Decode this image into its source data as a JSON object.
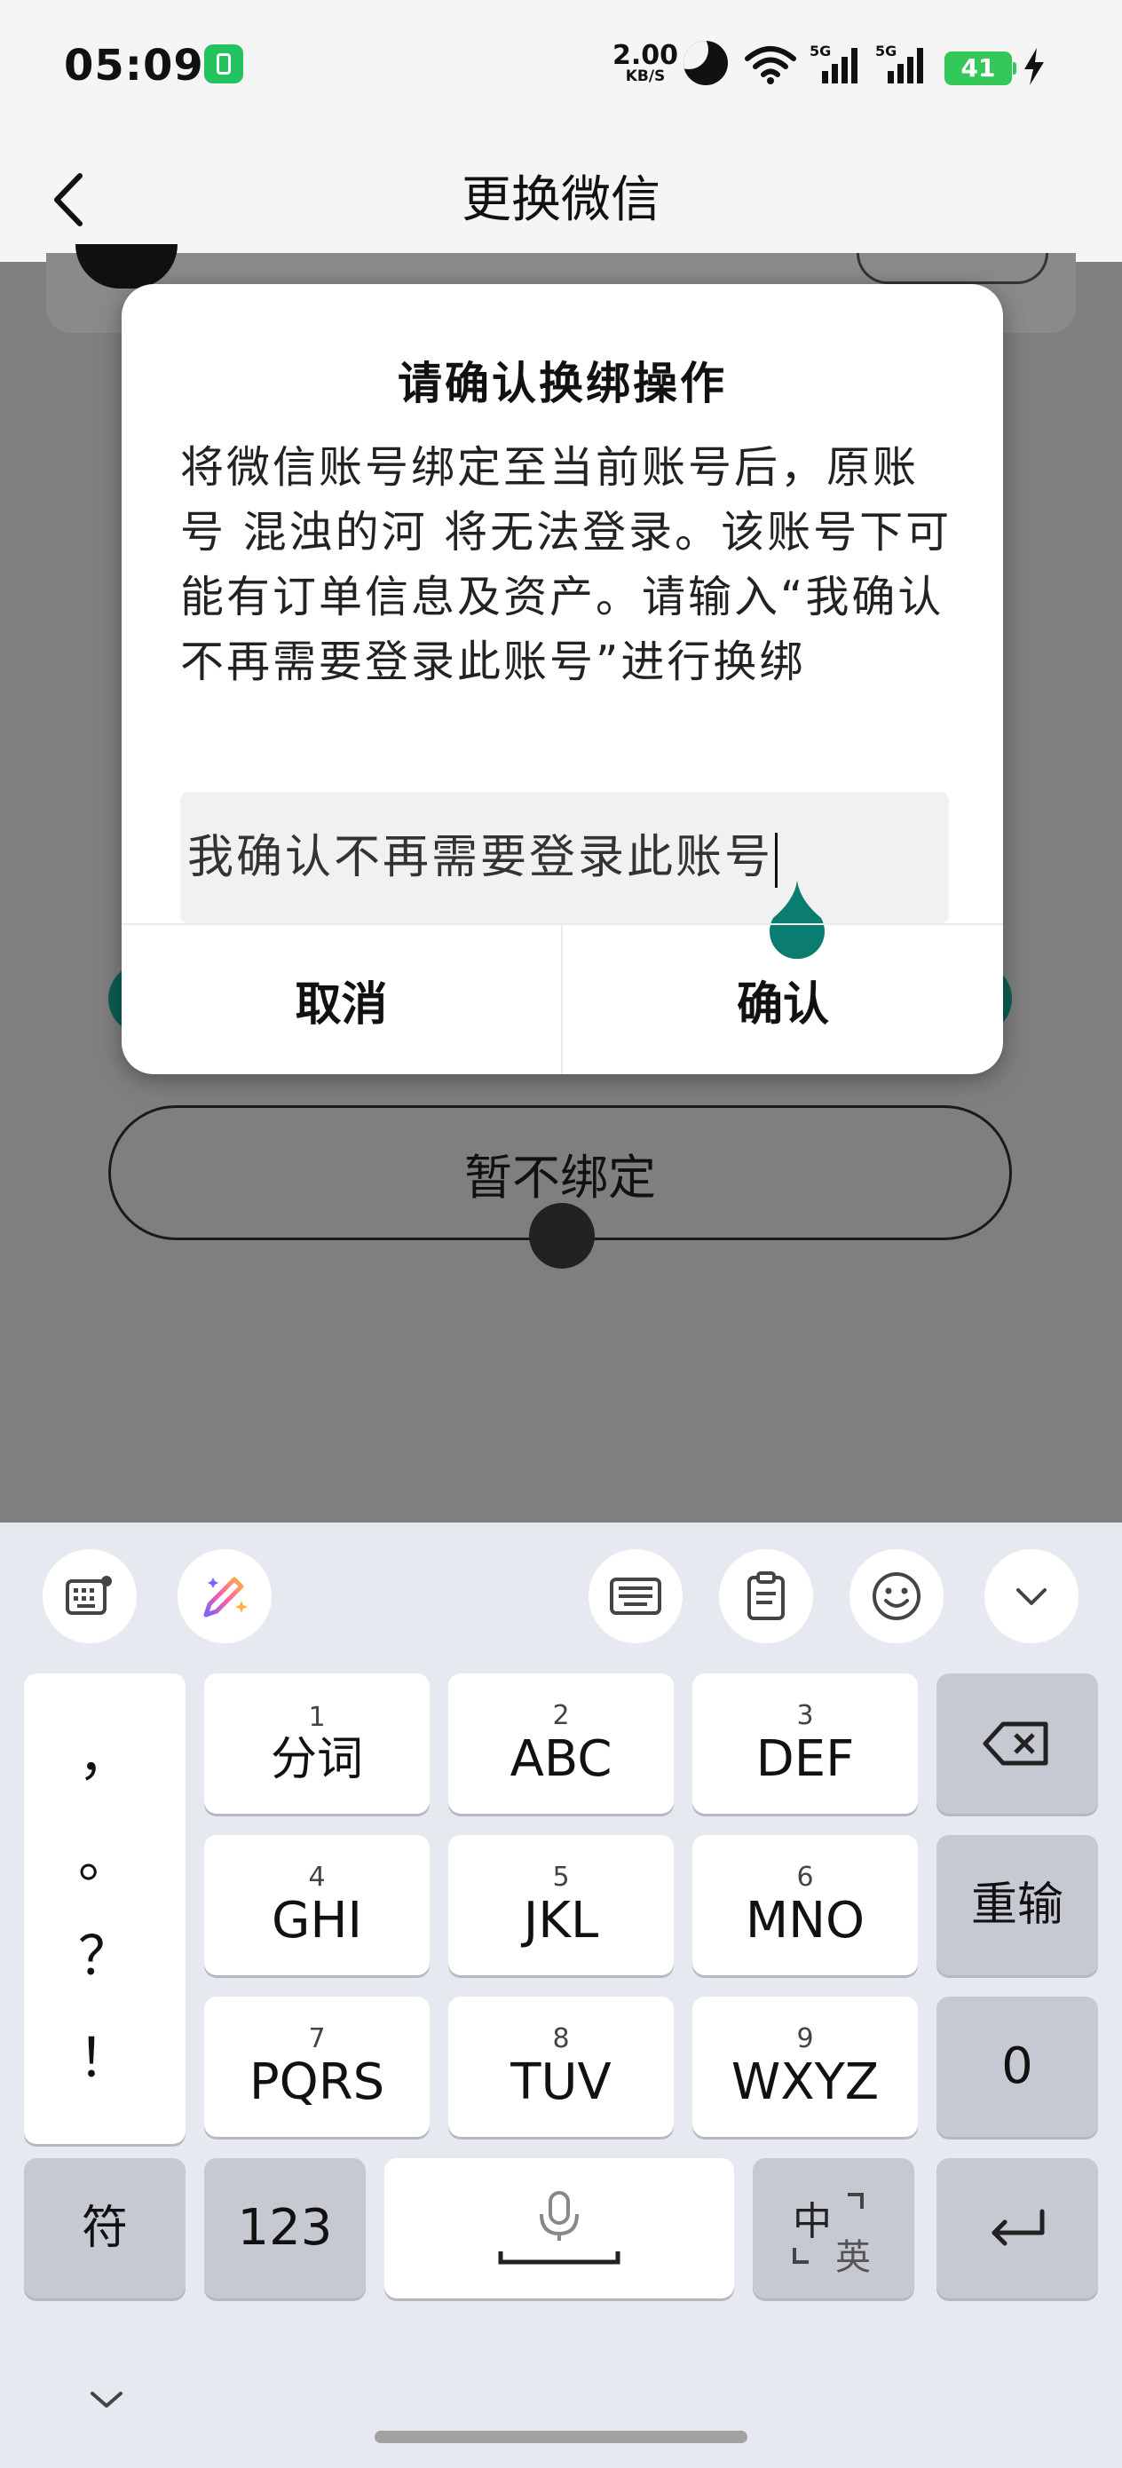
{
  "status_bar": {
    "time": "05:09",
    "net_speed_value": "2.00",
    "net_speed_unit": "KB/S",
    "signal_1_label": "5G",
    "signal_2_label": "5G",
    "battery": "41",
    "icons": [
      "app-icon",
      "moon-icon",
      "wifi-icon",
      "signal-icon",
      "signal-icon",
      "battery-icon",
      "charging-icon"
    ]
  },
  "header": {
    "title": "更换微信",
    "back_icon": "chevron-left-icon"
  },
  "page": {
    "skip_button": "暂不绑定"
  },
  "dialog": {
    "title": "请确认换绑操作",
    "body": "将微信账号绑定至当前账号后，原账号 混浊的河 将无法登录。该账号下可能有订单信息及资产。请输入“我确认不再需要登录此账号”进行换绑",
    "input_value": "我确认不再需要登录此账号",
    "cancel_label": "取消",
    "confirm_label": "确认",
    "accent_color": "#0a7d70"
  },
  "keyboard": {
    "toolbar": [
      "keyboard-settings-icon",
      "magic-pen-icon",
      "keyboard-layout-icon",
      "clipboard-icon",
      "emoji-icon",
      "chevron-down-icon"
    ],
    "punctuation": [
      "，",
      "。",
      "？",
      "！"
    ],
    "keys": [
      {
        "num": "1",
        "label": "分词"
      },
      {
        "num": "2",
        "label": "ABC"
      },
      {
        "num": "3",
        "label": "DEF"
      },
      {
        "num": "4",
        "label": "GHI"
      },
      {
        "num": "5",
        "label": "JKL"
      },
      {
        "num": "6",
        "label": "MNO"
      },
      {
        "num": "7",
        "label": "PQRS"
      },
      {
        "num": "8",
        "label": "TUV"
      },
      {
        "num": "9",
        "label": "WXYZ"
      }
    ],
    "reinput": "重输",
    "zero": "0",
    "symbols": "符",
    "numbers": "123",
    "lang_zh": "中",
    "lang_en": "英"
  }
}
